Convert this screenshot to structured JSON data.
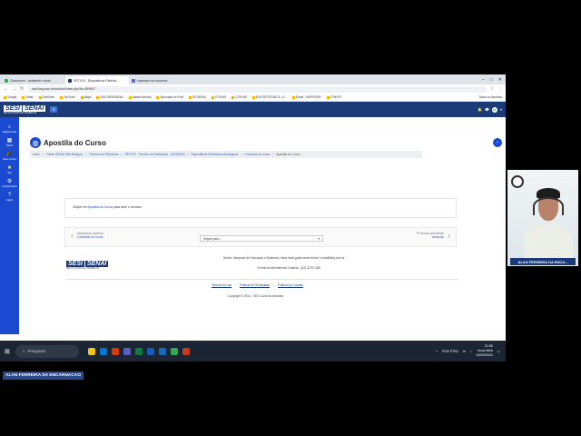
{
  "browser": {
    "tabs": [
      {
        "label": "Classroom - ambiente virtual",
        "color": "#34a853"
      },
      {
        "label": "SET476 - Dispositivos Eletrôni...",
        "color": "#1a3a78"
      },
      {
        "label": "Ingresse na conversa",
        "color": "#5b5fc7"
      }
    ],
    "url": "ead.fieg.com.br/mod/url/view.php?id=459947",
    "bookmarks": [
      "Google",
      "Gmail",
      "OneDrive",
      "YouTube",
      "Maps",
      "EAD SESI/SENAI",
      "Adobe Acrobat",
      "Aprovado do Profi",
      "SS SENAI",
      "CTM MS",
      "CTM MS",
      "ELETROTÉCNICA - E...",
      "Email - SUPERIOR",
      "CTM RS"
    ],
    "bookmarks_right": "Todos os favoritos"
  },
  "moodle": {
    "logo_left": "SESI",
    "logo_right": "SENAI",
    "logo_tagline": "PELO FUTURO DO TRABALHO",
    "avatar_initials": "AF",
    "sidebar": [
      {
        "label": "Página inicial"
      },
      {
        "label": "Painel"
      },
      {
        "label": "Meus cursos"
      },
      {
        "label": "Site"
      },
      {
        "label": "Configurações"
      },
      {
        "label": "Ajuda"
      }
    ],
    "page_title": "Apostila do Curso",
    "breadcrumb": [
      "Início",
      "Fieam SENAI São Bologna",
      "Técnico em Eletrônica",
      "SET476 - Técnico em Eletrônica - 2023/2024",
      "Dispositivos Eletrônicos Analógicos",
      "Conteúdo do curso",
      "Apostila do Curso"
    ],
    "info_prefix": "Clique em ",
    "info_link": "Apostila do Curso",
    "info_suffix": " para abrir o recurso.",
    "prev_label": "Atividade anterior",
    "prev_link": "Conteúdo do Curso",
    "jump_placeholder": "Seguir para...",
    "next_label": "Próxima atividade",
    "next_link": "Aulas Ao",
    "footer_line1": "Núcleo Integrado de Educação a Distância | https://ead.goias.senai.br/ead | nead@fieg.com.br",
    "footer_line2": "Central de Atendimento Gratuita - (62) 3219-1300",
    "footer_links": [
      "Termos De Uso",
      "Política De Privacidade",
      "Política De Cookies"
    ],
    "copyright": "Copyright © 2024 - FIEG Casa da Indústria"
  },
  "taskbar": {
    "search": "Pesquisar",
    "lang": "POR PTB2",
    "time": "21:06",
    "day": "terça-feira",
    "date": "02/04/2024"
  },
  "webcam_name": "ALAN FERREIRA DA ENCA...",
  "participant_tag": "ALAN FERREIRA DA ENCARNACAO"
}
